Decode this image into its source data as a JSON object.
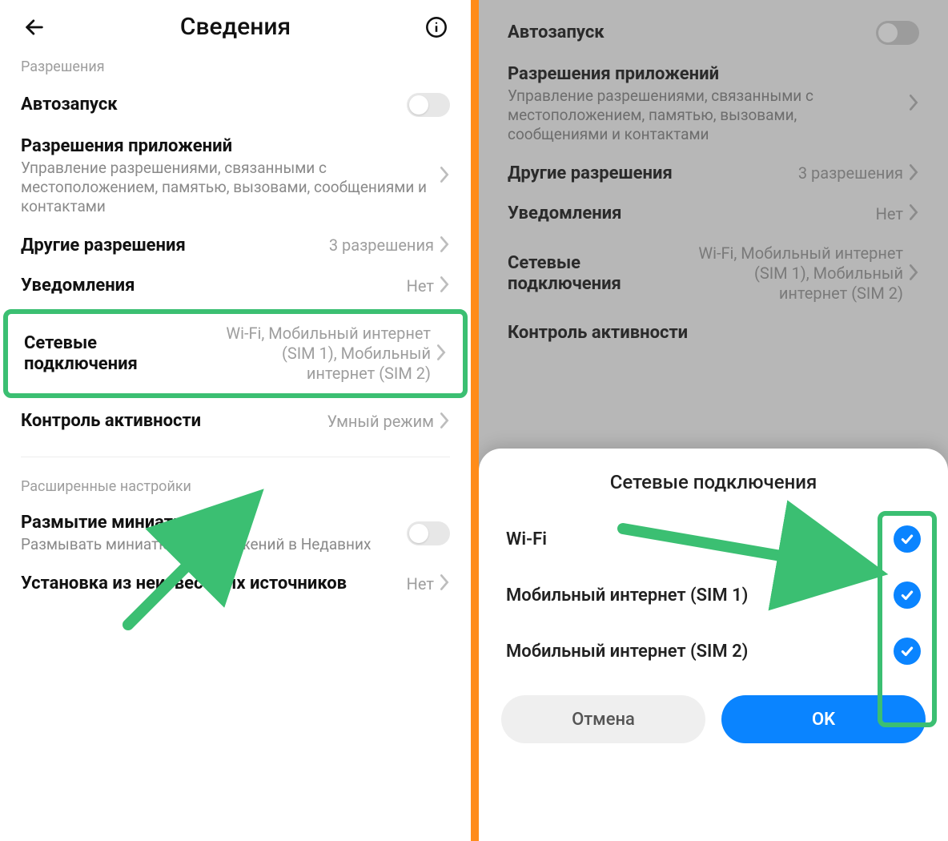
{
  "left": {
    "header_title": "Сведения",
    "section_permissions": "Разрешения",
    "autostart": "Автозапуск",
    "app_perms_title": "Разрешения приложений",
    "app_perms_sub": "Управление разрешениями, связанными с местоположением, памятью, вызовами, сообщениями и контактами",
    "other_perms_title": "Другие разрешения",
    "other_perms_val": "3 разрешения",
    "notifications_title": "Уведомления",
    "notifications_val": "Нет",
    "network_title": "Сетевые подключения",
    "network_val": "Wi-Fi, Мобильный интернет (SIM 1), Мобильный интернет (SIM 2)",
    "activity_title": "Контроль активности",
    "activity_val": "Умный режим",
    "section_advanced": "Расширенные настройки",
    "blur_title": "Размытие миниатюр",
    "blur_sub": "Размывать миниатюры приложений в Недавних",
    "unknown_title": "Установка из неизвестных источников",
    "unknown_val": "Нет"
  },
  "right": {
    "autostart": "Автозапуск",
    "app_perms_title": "Разрешения приложений",
    "app_perms_sub": "Управление разрешениями, связанными с местоположением, памятью, вызовами, сообщениями и контактами",
    "other_perms_title": "Другие разрешения",
    "other_perms_val": "3 разрешения",
    "notifications_title": "Уведомления",
    "notifications_val": "Нет",
    "network_title": "Сетевые подключения",
    "network_val": "Wi-Fi, Мобильный интернет (SIM 1), Мобильный интернет (SIM 2)",
    "activity_title": "Контроль активности",
    "dialog": {
      "title": "Сетевые подключения",
      "options": [
        {
          "label": "Wi-Fi",
          "checked": true
        },
        {
          "label": "Мобильный интернет (SIM 1)",
          "checked": true
        },
        {
          "label": "Мобильный интернет (SIM 2)",
          "checked": true
        }
      ],
      "cancel": "Отмена",
      "ok": "OK"
    }
  },
  "colors": {
    "highlight": "#3bbf72",
    "accent_blue": "#0a84ff",
    "divider": "#ff8c1a"
  }
}
